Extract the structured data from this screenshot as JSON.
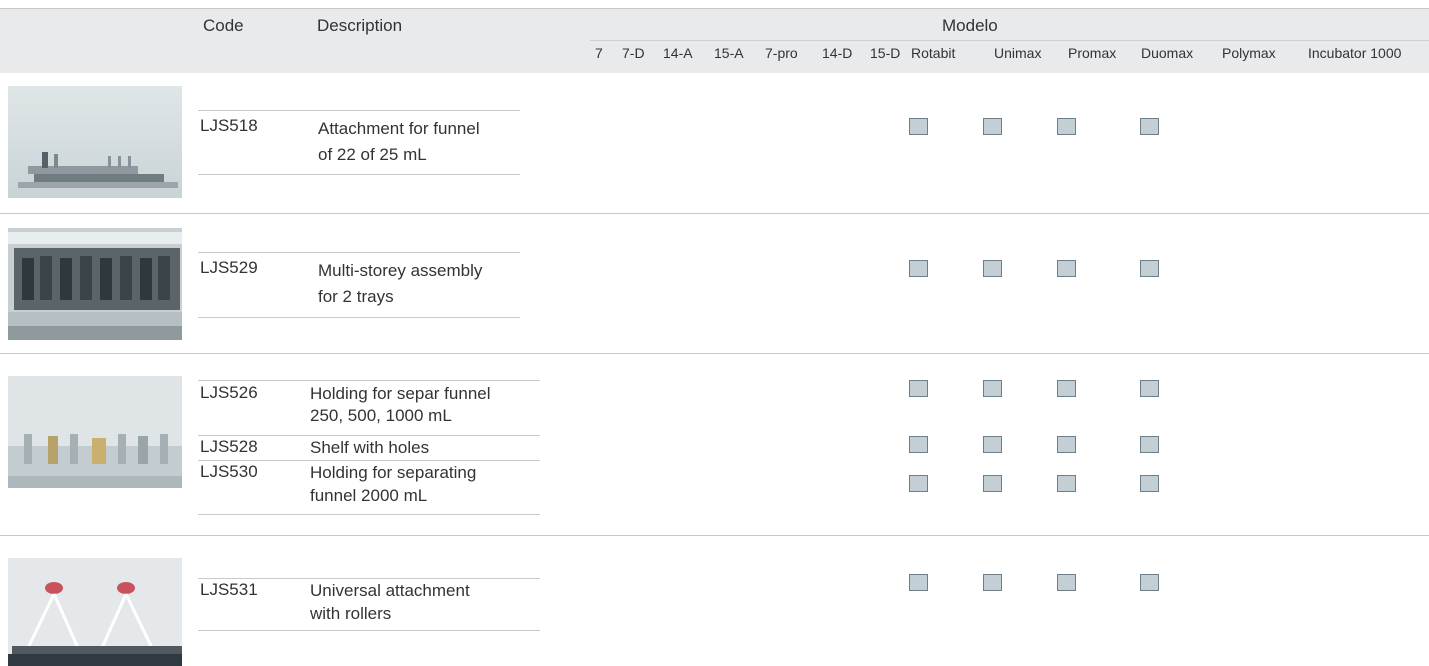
{
  "header": {
    "code_label": "Code",
    "description_label": "Description",
    "modelo_label": "Modelo",
    "models": [
      "7",
      "7-D",
      "14-A",
      "15-A",
      "7-pro",
      "14-D",
      "15-D",
      "Rotabit",
      "Unimax",
      "Promax",
      "Duomax",
      "Polymax",
      "Incubator 1000"
    ]
  },
  "rows": [
    {
      "code": "LJS518",
      "desc1": "Attachment for funnel",
      "desc2": "of 22 of 25 mL",
      "checked_models": [
        "Rotabit",
        "Unimax",
        "Promax",
        "Duomax"
      ]
    },
    {
      "code": "LJS529",
      "desc1": "Multi-storey assembly",
      "desc2": "for 2 trays",
      "checked_models": [
        "Rotabit",
        "Unimax",
        "Promax",
        "Duomax"
      ]
    },
    {
      "code": "LJS526",
      "desc1": "Holding for separ funnel",
      "desc2": "250, 500, 1000 mL",
      "checked_models": [
        "Rotabit",
        "Unimax",
        "Promax",
        "Duomax"
      ]
    },
    {
      "code": "LJS528",
      "desc1": "Shelf with holes",
      "desc2": "",
      "checked_models": [
        "Rotabit",
        "Unimax",
        "Promax",
        "Duomax"
      ]
    },
    {
      "code": "LJS530",
      "desc1": "Holding for separating",
      "desc2": "funnel 2000 mL",
      "checked_models": [
        "Rotabit",
        "Unimax",
        "Promax",
        "Duomax"
      ]
    },
    {
      "code": "LJS531",
      "desc1": "Universal attachment",
      "desc2": "with rollers",
      "checked_models": [
        "Rotabit",
        "Unimax",
        "Promax",
        "Duomax"
      ]
    }
  ],
  "colors": {
    "header_band": "#e8eaeb",
    "checkbox_fill": "#c4ced5",
    "checkbox_border": "#6f7f8a"
  }
}
